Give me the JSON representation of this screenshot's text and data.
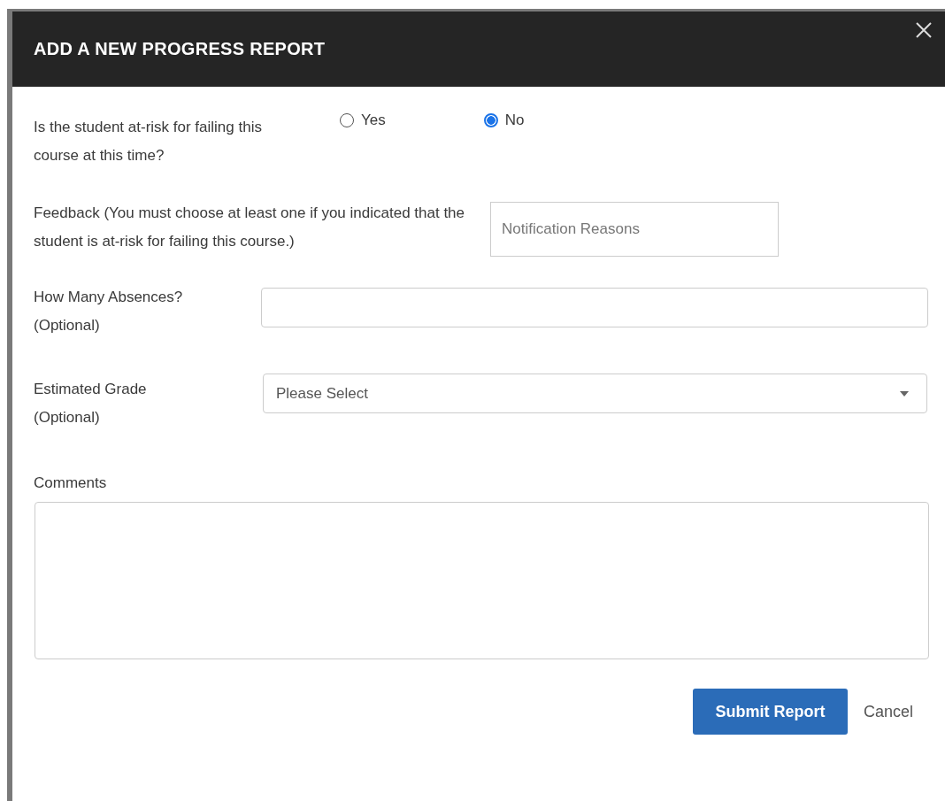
{
  "dialog": {
    "title": "ADD A NEW PROGRESS REPORT"
  },
  "at_risk": {
    "label": "Is the student at-risk for failing this course at this time?",
    "options": [
      {
        "label": "Yes",
        "selected": false
      },
      {
        "label": "No",
        "selected": true
      }
    ]
  },
  "feedback": {
    "label": "Feedback (You must choose at least one if you indicated that the student is at-risk for failing this course.)",
    "placeholder": "Notification Reasons"
  },
  "absences": {
    "label": "How Many Absences?",
    "note": "(Optional)"
  },
  "grade": {
    "label": "Estimated Grade",
    "note": "(Optional)",
    "value": "Please Select"
  },
  "comments": {
    "label": "Comments"
  },
  "buttons": [
    {
      "label": "Submit Report",
      "kind": "primary"
    },
    {
      "label": "Cancel",
      "kind": "link"
    }
  ]
}
